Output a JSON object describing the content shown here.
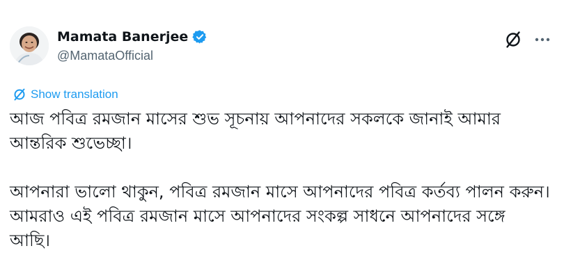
{
  "author": {
    "name": "Mamata Banerjee",
    "handle": "@MamataOfficial",
    "verified": true,
    "verified_color": "#1d9bf0"
  },
  "actions": {
    "grok_icon": "grok-icon",
    "more_icon": "more-icon"
  },
  "translate": {
    "label": "Show translation",
    "color": "#1d9bf0"
  },
  "tweet": {
    "paragraphs": [
      "আজ পবিত্র রমজান মাসের শুভ সূচনায় আপনাদের সকলকে জানাই আমার আন্তরিক শুভেচ্ছা।",
      "আপনারা ভালো থাকুন, পবিত্র রমজান মাসে আপনাদের পবিত্র কর্তব্য পালন করুন। আমরাও এই পবিত্র রমজান মাসে আপনাদের সংকল্প সাধনে আপনাদের সঙ্গে আছি।"
    ]
  }
}
